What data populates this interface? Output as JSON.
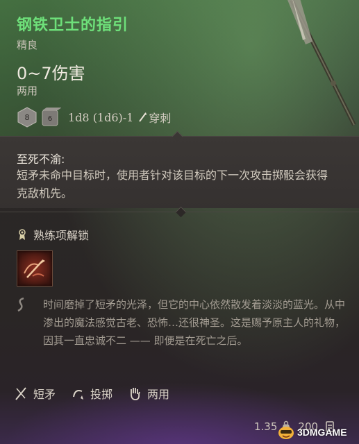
{
  "item": {
    "name": "钢铁卫士的指引",
    "rarity": "精良",
    "damage_range": "0~7伤害",
    "handedness": "两用",
    "dice_formula": "1d8 (1d6)-1",
    "damage_type": "穿刺",
    "die_faces": [
      "8",
      "6"
    ]
  },
  "passive": {
    "title": "至死不渝:",
    "text": "短矛未命中目标时，使用者针对该目标的下一次攻击掷骰会获得克敌机先。"
  },
  "proficiency": {
    "label": "熟练项解锁"
  },
  "lore": {
    "text": "时间磨掉了短矛的光泽，但它的中心依然散发着淡淡的蓝光。从中渗出的魔法感觉古老、恐怖…还很神圣。这是赐予原主人的礼物，因其一直忠诚不二 —— 即便是在死亡之后。"
  },
  "tags": [
    {
      "label": "短矛",
      "icon": "spear-icon"
    },
    {
      "label": "投掷",
      "icon": "throw-icon"
    },
    {
      "label": "两用",
      "icon": "hand-icon"
    }
  ],
  "footer": {
    "weight": "1.35",
    "price": "200"
  },
  "watermark": {
    "text": "3DMGAME"
  },
  "colors": {
    "title_green": "#6ee07a",
    "accent_purple": "#6b3c9a"
  }
}
